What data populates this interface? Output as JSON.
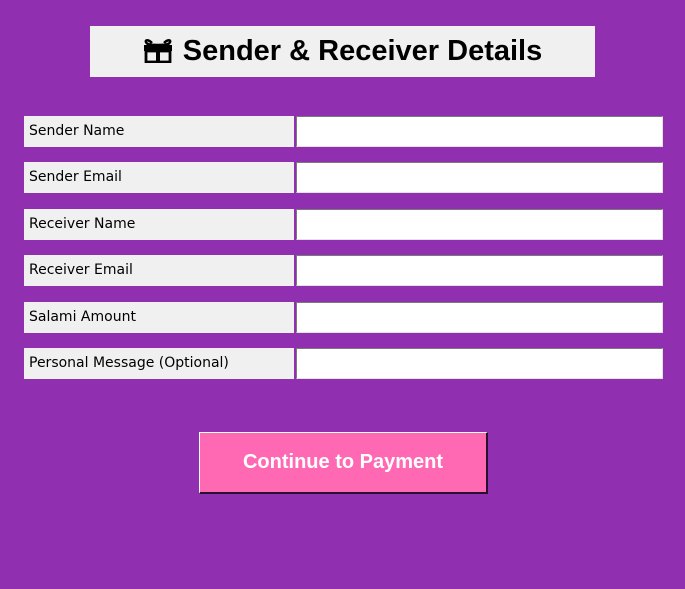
{
  "header": {
    "icon": "gift-icon",
    "title": "Sender & Receiver Details"
  },
  "form": {
    "fields": [
      {
        "label": "Sender Name",
        "value": ""
      },
      {
        "label": "Sender Email",
        "value": ""
      },
      {
        "label": "Receiver Name",
        "value": ""
      },
      {
        "label": "Receiver Email",
        "value": ""
      },
      {
        "label": "Salami Amount",
        "value": ""
      },
      {
        "label": "Personal Message (Optional)",
        "value": ""
      }
    ],
    "submit_label": "Continue to Payment"
  },
  "colors": {
    "background": "#9030b0",
    "label_background": "#f0f0f0",
    "button": "#ff69b4",
    "button_text": "#ffffff"
  }
}
